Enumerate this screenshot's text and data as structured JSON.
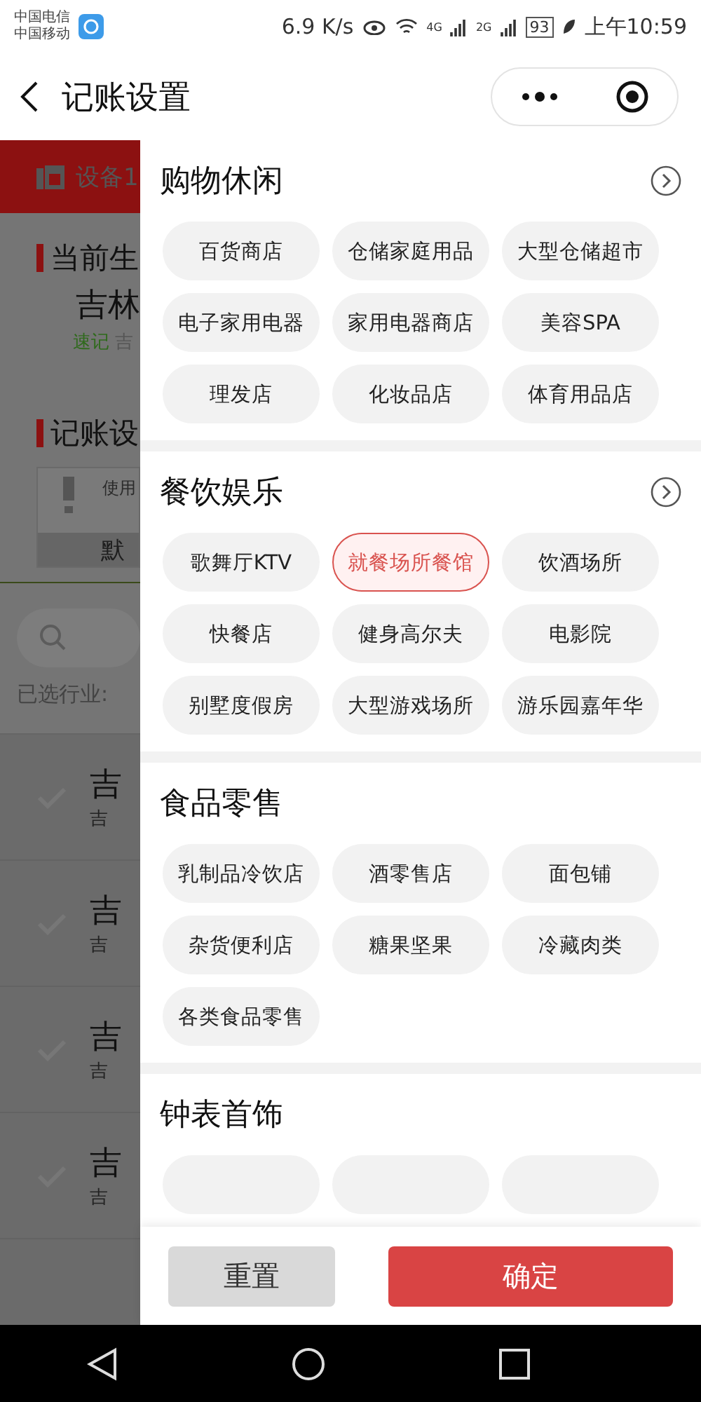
{
  "status_bar": {
    "carriers": [
      "中国电信",
      "中国移动"
    ],
    "speed": "6.9 K/s",
    "network_1": "4G",
    "network_2": "2G",
    "battery": "93",
    "time": "上午10:59"
  },
  "nav": {
    "title": "记账设置"
  },
  "background": {
    "device": "设备1",
    "section_1": "当前生",
    "name": "吉林",
    "tag": "速记",
    "tag_text": "吉",
    "section_2": "记账设",
    "notice_text": "使用",
    "notice_button": "默",
    "filter_label": "已选行业:",
    "items": [
      {
        "title": "吉",
        "subtitle": "吉"
      },
      {
        "title": "吉",
        "subtitle": "吉"
      },
      {
        "title": "吉",
        "subtitle": "吉"
      },
      {
        "title": "吉",
        "subtitle": "吉"
      }
    ]
  },
  "drawer": {
    "sections": [
      {
        "title": "购物休闲",
        "more": true,
        "chips": [
          {
            "label": "百货商店",
            "selected": false
          },
          {
            "label": "仓储家庭用品",
            "selected": false
          },
          {
            "label": "大型仓储超市",
            "selected": false
          },
          {
            "label": "电子家用电器",
            "selected": false
          },
          {
            "label": "家用电器商店",
            "selected": false
          },
          {
            "label": "美容SPA",
            "selected": false
          },
          {
            "label": "理发店",
            "selected": false
          },
          {
            "label": "化妆品店",
            "selected": false
          },
          {
            "label": "体育用品店",
            "selected": false
          }
        ]
      },
      {
        "title": "餐饮娱乐",
        "more": true,
        "chips": [
          {
            "label": "歌舞厅KTV",
            "selected": false
          },
          {
            "label": "就餐场所餐馆",
            "selected": true
          },
          {
            "label": "饮酒场所",
            "selected": false
          },
          {
            "label": "快餐店",
            "selected": false
          },
          {
            "label": "健身高尔夫",
            "selected": false
          },
          {
            "label": "电影院",
            "selected": false
          },
          {
            "label": "别墅度假房",
            "selected": false
          },
          {
            "label": "大型游戏场所",
            "selected": false
          },
          {
            "label": "游乐园嘉年华",
            "selected": false
          }
        ]
      },
      {
        "title": "食品零售",
        "more": false,
        "chips": [
          {
            "label": "乳制品冷饮店",
            "selected": false
          },
          {
            "label": "酒零售店",
            "selected": false
          },
          {
            "label": "面包铺",
            "selected": false
          },
          {
            "label": "杂货便利店",
            "selected": false
          },
          {
            "label": "糖果坚果",
            "selected": false
          },
          {
            "label": "冷藏肉类",
            "selected": false
          },
          {
            "label": "各类食品零售",
            "selected": false
          }
        ]
      },
      {
        "title": "钟表首饰",
        "more": false,
        "chips": [
          {
            "selected": false
          },
          {
            "selected": false
          },
          {
            "selected": false
          }
        ]
      }
    ],
    "buttons": {
      "reset": "重置",
      "confirm": "确定"
    }
  }
}
